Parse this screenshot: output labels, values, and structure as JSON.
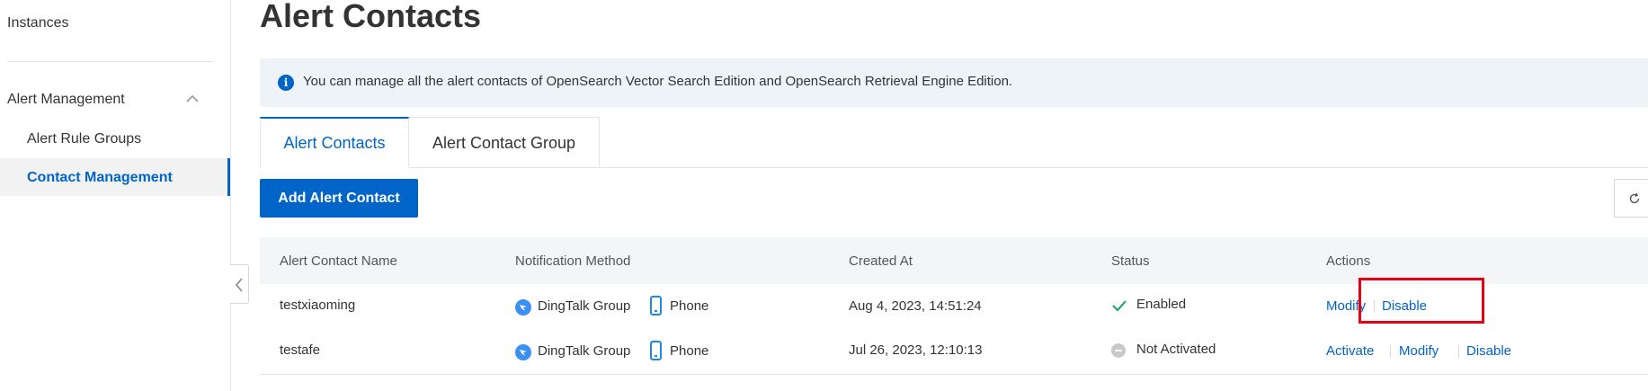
{
  "sidebar": {
    "instances": "Instances",
    "group_label": "Alert Management",
    "items": [
      {
        "label": "Alert Rule Groups"
      },
      {
        "label": "Contact Management"
      }
    ]
  },
  "page": {
    "title": "Alert Contacts",
    "info": "You can manage all the alert contacts of OpenSearch Vector Search Edition and OpenSearch Retrieval Engine Edition."
  },
  "tabs": [
    {
      "label": "Alert Contacts",
      "active": true
    },
    {
      "label": "Alert Contact Group",
      "active": false
    }
  ],
  "toolbar": {
    "add_label": "Add Alert Contact"
  },
  "table": {
    "columns": [
      "Alert Contact Name",
      "Notification Method",
      "Created At",
      "Status",
      "Actions"
    ],
    "rows": [
      {
        "name": "testxiaoming",
        "methods": [
          "DingTalk Group",
          "Phone"
        ],
        "created": "Aug 4, 2023, 14:51:24",
        "status": "Enabled",
        "actions": [
          "Modify",
          "Disable"
        ]
      },
      {
        "name": "testafe",
        "methods": [
          "DingTalk Group",
          "Phone"
        ],
        "created": "Jul 26, 2023, 12:10:13",
        "status": "Not Activated",
        "actions": [
          "Activate",
          "Modify",
          "Disable"
        ]
      }
    ]
  },
  "colors": {
    "accent": "#0064c8",
    "success": "#1aa15f",
    "highlight": "#e60012"
  },
  "icons": [
    "info-icon",
    "chevron-up-icon",
    "chevron-left-icon",
    "refresh-icon",
    "dingtalk-icon",
    "phone-icon",
    "check-icon",
    "disabled-status-icon"
  ]
}
